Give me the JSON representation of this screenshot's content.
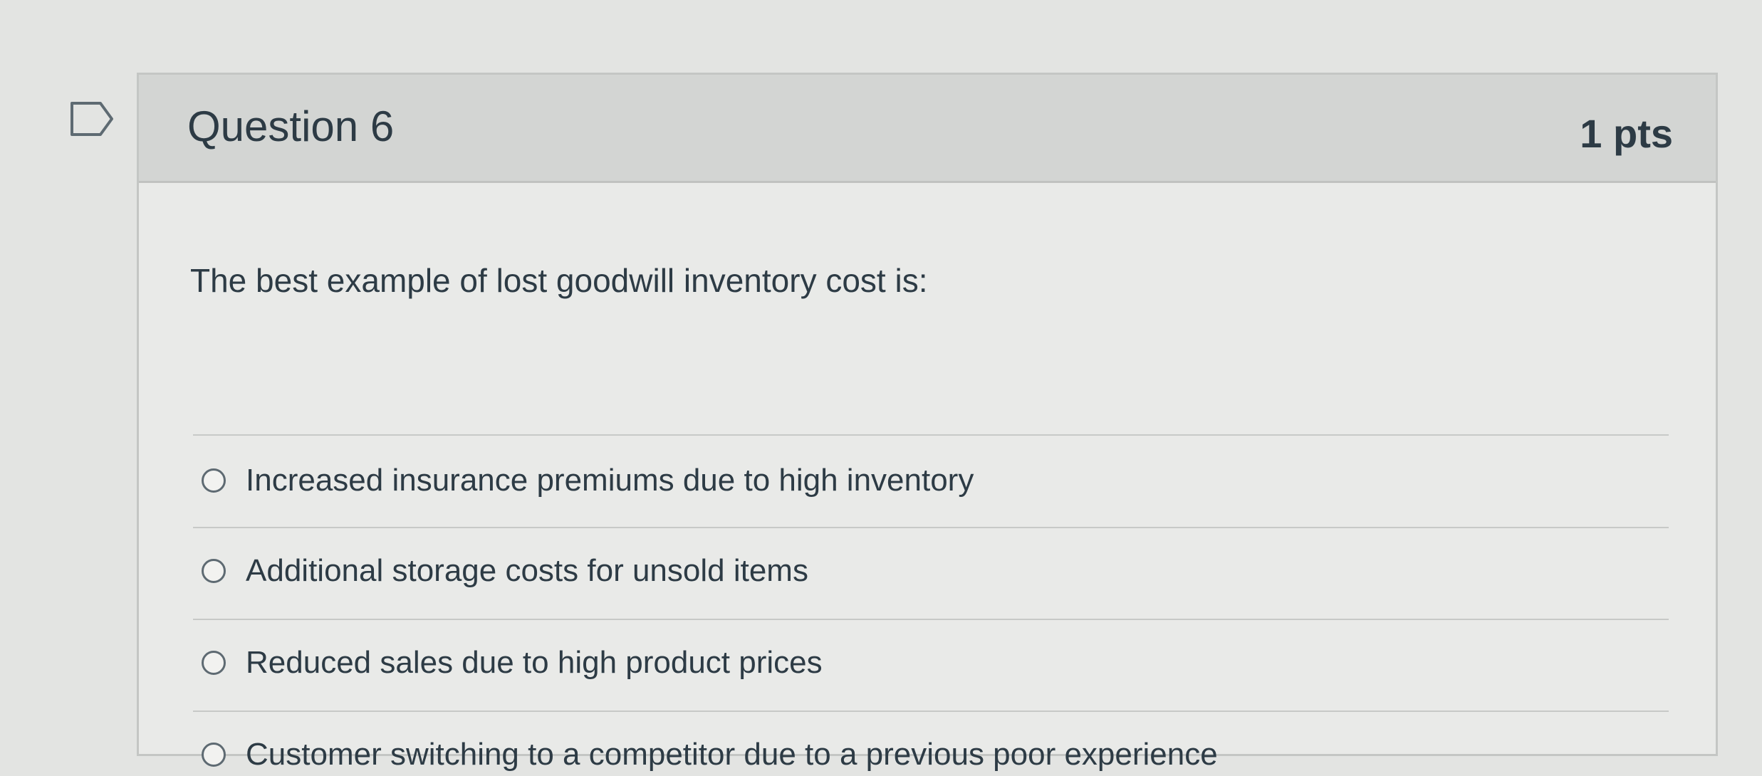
{
  "question": {
    "title": "Question 6",
    "points": "1 pts",
    "text": "The best example of lost goodwill inventory cost is:",
    "answers": [
      {
        "label": "Increased insurance premiums due to high inventory",
        "selected": false
      },
      {
        "label": "Additional storage costs for unsold items",
        "selected": false
      },
      {
        "label": "Reduced sales due to high product prices",
        "selected": false
      },
      {
        "label": "Customer switching to a competitor due to a previous poor experience",
        "selected": false
      }
    ]
  },
  "icons": {
    "flag": "flag-question-icon",
    "radio": "radio-unselected-icon"
  },
  "colors": {
    "page_background": "#e3e4e2",
    "header_background": "#d3d5d3",
    "card_background": "#e9eae8",
    "text": "#2d3b45",
    "border": "#c4c6c4"
  }
}
